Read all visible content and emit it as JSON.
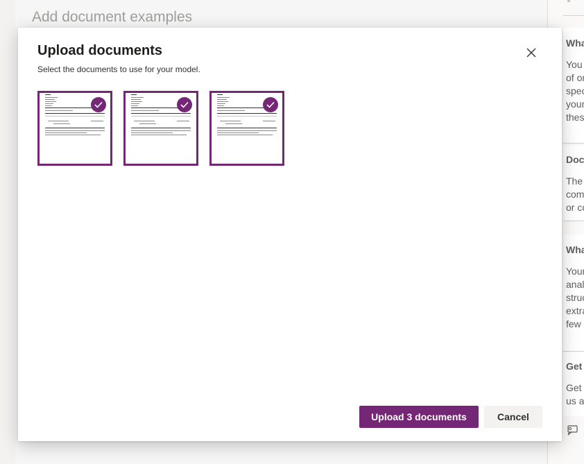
{
  "background": {
    "page_title": "Add document examples"
  },
  "right_panel": {
    "cards": [
      {
        "heading": "Wha",
        "text": "You\nof or\nspec\nyour\nthes"
      },
      {
        "heading": "Docu",
        "text": "The\ncom\nor co"
      },
      {
        "heading": "Wha",
        "text": "Your\nanaly\nstruc\nextra\nfew"
      },
      {
        "heading": "Get",
        "text": "Get\nus al"
      }
    ],
    "footer_icon": "feedback-icon"
  },
  "dialog": {
    "title": "Upload documents",
    "subtitle": "Select the documents to use for your model.",
    "close_icon": "close-icon",
    "thumbnails": [
      {
        "name": "document-thumbnail-1",
        "selected": true
      },
      {
        "name": "document-thumbnail-2",
        "selected": true
      },
      {
        "name": "document-thumbnail-3",
        "selected": true
      }
    ],
    "upload_button": "Upload 3 documents",
    "cancel_button": "Cancel"
  },
  "colors": {
    "accent": "#742774",
    "secondary_button_bg": "#f3f2f1"
  }
}
